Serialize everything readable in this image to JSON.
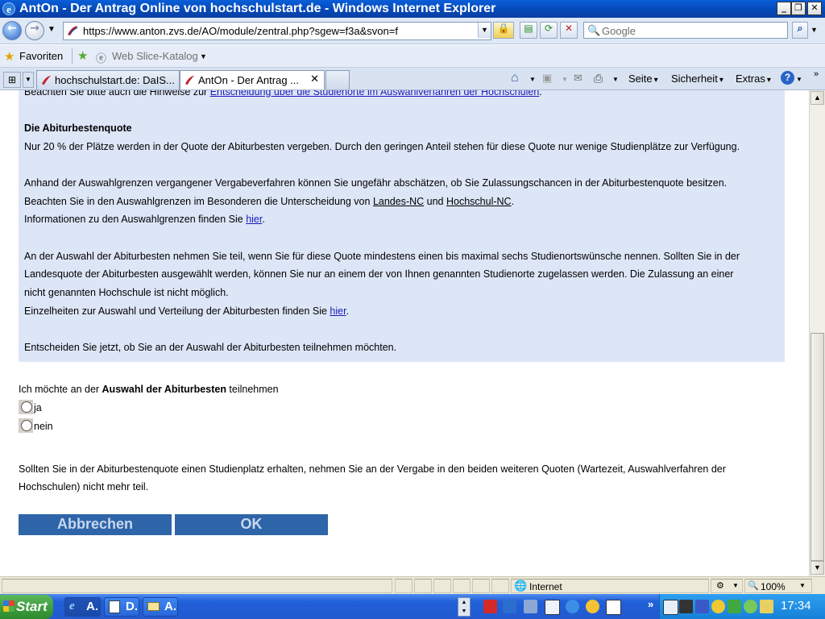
{
  "window": {
    "title": "AntOn - Der Antrag Online von hochschulstart.de - Windows Internet Explorer",
    "minimize": "_",
    "restore": "❐",
    "close": "✕"
  },
  "addressbar": {
    "url": "https://www.anton.zvs.de/AO/module/zentral.php?sgew=f3a&svon=f",
    "search_placeholder": "Google"
  },
  "favorites": {
    "favorites_label": "Favoriten",
    "webslice_label": "Web Slice-Katalog"
  },
  "tabs": [
    {
      "label": "hochschulstart.de: DaIS...",
      "active": false
    },
    {
      "label": "AntOn - Der Antrag ...",
      "active": true
    }
  ],
  "commandbar": {
    "page": "Seite",
    "security": "Sicherheit",
    "extras": "Extras"
  },
  "content": {
    "top_text": "Beachten Sie bitte auch die Hinweise zur ",
    "top_link": "Entscheidung über die Studienorte im Auswahlverfahren der Hochschulen",
    "heading": "Die Abiturbestenquote",
    "p1": "Nur 20 % der Plätze werden in der Quote der Abiturbesten vergeben. Durch den geringen Anteil stehen für diese Quote nur wenige Studienplätze zur Verfügung.",
    "p2_line1": "Anhand der Auswahlgrenzen vergangener Vergabeverfahren können Sie ungefähr abschätzen, ob Sie Zulassungschancen in der Abiturbestenquote besitzen.",
    "p2_line2_a": "Beachten Sie in den Auswahlgrenzen im Besonderen die Unterscheidung von ",
    "p2_link_landes": "Landes-NC",
    "p2_line2_b": " und ",
    "p2_link_hochschul": "Hochschul-NC",
    "p2_line3_a": "Informationen zu den Auswahlgrenzen finden Sie ",
    "p2_link_hier": "hier",
    "p3_line1": "An der Auswahl der Abiturbesten nehmen Sie teil, wenn Sie für diese Quote mindestens einen bis maximal sechs Studienortswünsche nennen. Sollten Sie in der",
    "p3_line2": "Landesquote der Abiturbesten ausgewählt werden, können Sie nur an einem der von Ihnen genannten Studienorte zugelassen werden. Die Zulassung an einer",
    "p3_line3": "nicht genannten Hochschule ist nicht möglich.",
    "p3_line4_a": "Einzelheiten zur Auswahl und Verteilung der Abiturbesten finden Sie ",
    "p3_link_hier": "hier",
    "p4": "Entscheiden Sie jetzt, ob Sie an der Auswahl der Abiturbesten teilnehmen möchten.",
    "question_a": "Ich möchte an der ",
    "question_bold": "Auswahl der Abiturbesten",
    "question_b": " teilnehmen",
    "option_yes": "ja",
    "option_no": "nein",
    "note_line1": "Sollten Sie in der Abiturbestenquote einen Studienplatz erhalten, nehmen Sie an der Vergabe in den beiden weiteren Quoten (Wartezeit, Auswahlverfahren der",
    "note_line2": "Hochschulen) nicht mehr teil.",
    "cancel_button": "Abbrechen",
    "ok_button": "OK"
  },
  "statusbar": {
    "zone": "Internet",
    "zoom": "100%"
  },
  "taskbar": {
    "start": "Start",
    "items": [
      "A.",
      "D.",
      "A."
    ],
    "clock": "17:34"
  },
  "colors": {
    "infobox_bg": "#dde6f7",
    "button_bg": "#2e64a8",
    "link": "#1a1ab8"
  }
}
